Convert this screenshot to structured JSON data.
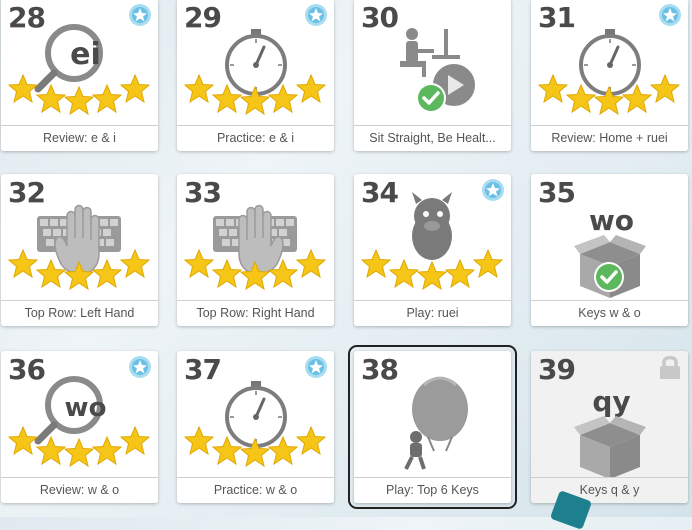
{
  "lessons": [
    {
      "num": "28",
      "label": "Review: e & i",
      "center": "ei"
    },
    {
      "num": "29",
      "label": "Practice: e & i"
    },
    {
      "num": "30",
      "label": "Sit Straight, Be Healt..."
    },
    {
      "num": "31",
      "label": "Review: Home + ruei"
    },
    {
      "num": "32",
      "label": "Top Row: Left Hand"
    },
    {
      "num": "33",
      "label": "Top Row: Right Hand"
    },
    {
      "num": "34",
      "label": "Play: ruei"
    },
    {
      "num": "35",
      "label": "Keys w & o",
      "center": "wo"
    },
    {
      "num": "36",
      "label": "Review: w & o",
      "center": "wo"
    },
    {
      "num": "37",
      "label": "Practice: w & o"
    },
    {
      "num": "38",
      "label": "Play: Top 6 Keys"
    },
    {
      "num": "39",
      "label": "Keys q & y",
      "center": "qy"
    }
  ],
  "colors": {
    "star": "#f5c518",
    "check": "#5cb85c",
    "badge": "#7cc8e8",
    "gray": "#7d7d7d",
    "selected": "#222222"
  },
  "icons": [
    "star-icon",
    "badge-icon",
    "magnifier-icon",
    "stopwatch-icon",
    "checkmark-icon",
    "keyboard-icon",
    "hand-icon",
    "lock-icon",
    "box-icon",
    "monster-icon",
    "balloon-icon"
  ]
}
